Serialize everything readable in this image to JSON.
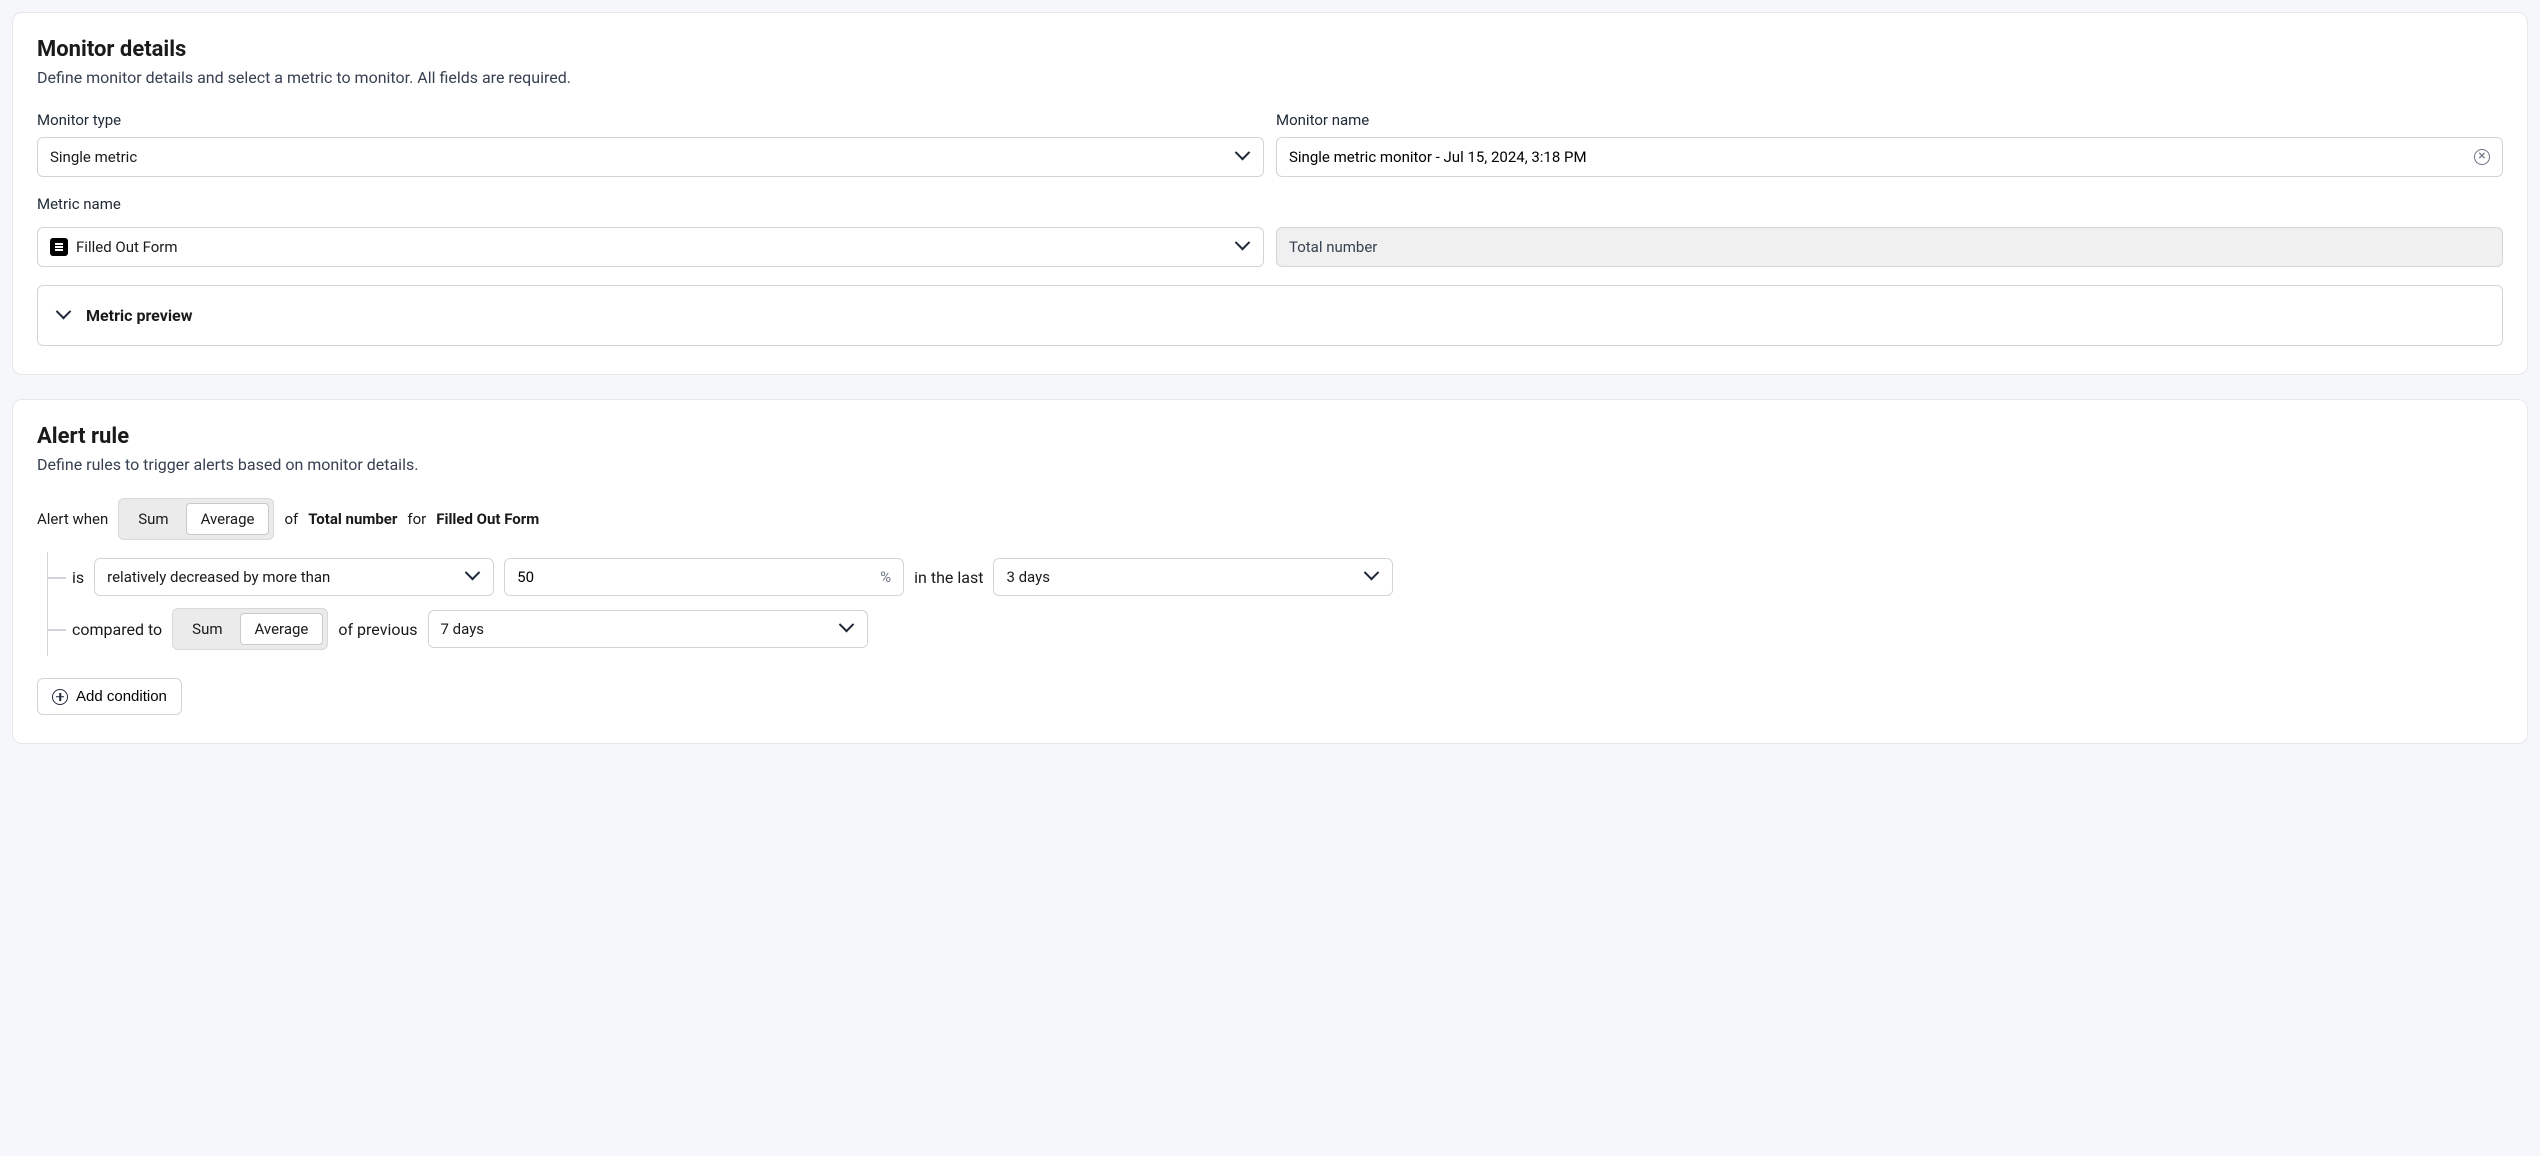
{
  "monitor_details": {
    "title": "Monitor details",
    "description": "Define monitor details and select a metric to monitor. All fields are required.",
    "monitor_type": {
      "label": "Monitor type",
      "value": "Single metric"
    },
    "monitor_name": {
      "label": "Monitor name",
      "value": "Single metric monitor - Jul 15, 2024, 3:18 PM"
    },
    "metric_name": {
      "label": "Metric name",
      "value": "Filled Out Form",
      "aggregation": "Total number"
    },
    "preview_label": "Metric preview"
  },
  "alert_rule": {
    "title": "Alert rule",
    "description": "Define rules to trigger alerts based on monitor details.",
    "line1": {
      "prefix": "Alert when",
      "seg_sum": "Sum",
      "seg_avg": "Average",
      "of": "of",
      "measure": "Total number",
      "for": "for",
      "subject": "Filled Out Form"
    },
    "line2": {
      "is": "is",
      "condition": "relatively decreased by more than",
      "value": "50",
      "unit": "%",
      "in_last": "in the last",
      "window": "3 days"
    },
    "line3": {
      "compared_to": "compared to",
      "seg_sum": "Sum",
      "seg_avg": "Average",
      "of_previous": "of previous",
      "window": "7 days"
    },
    "add_condition_label": "Add condition"
  }
}
